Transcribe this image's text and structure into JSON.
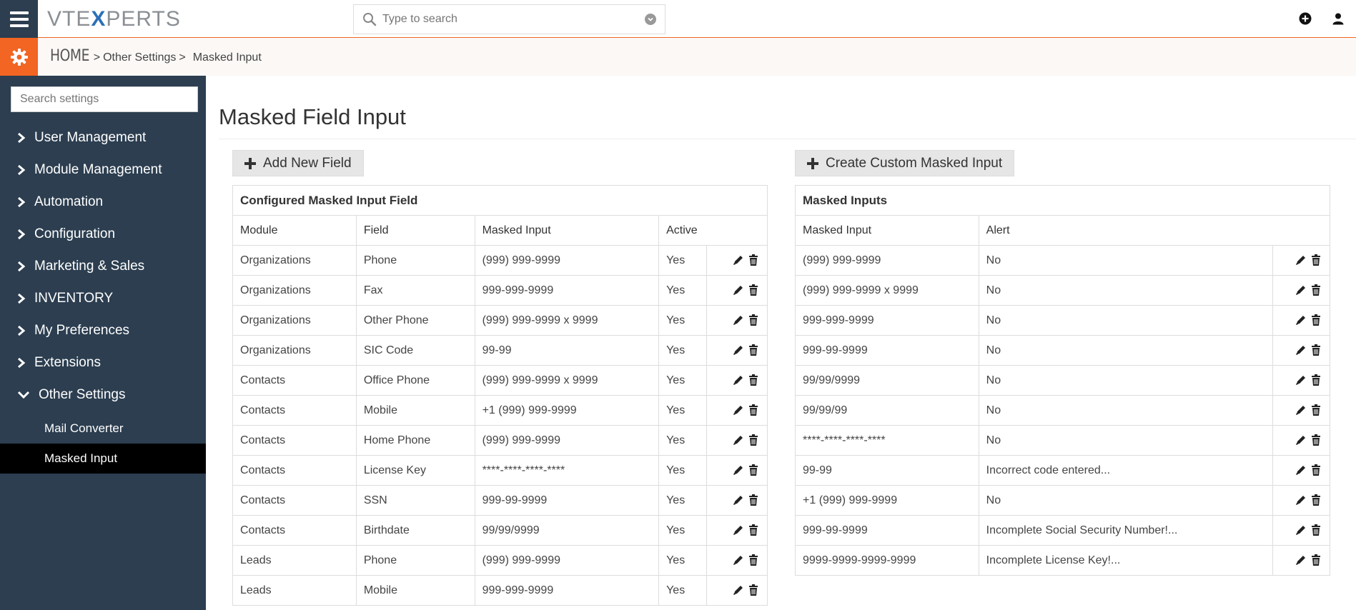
{
  "header": {
    "logo_left": "VTE",
    "logo_x": "X",
    "logo_right": "PERTS",
    "search_placeholder": "Type to search"
  },
  "breadcrumb": {
    "home": "HOME",
    "sep1": ">",
    "item1": "Other Settings",
    "sep2": ">",
    "current": "Masked Input"
  },
  "sidebar": {
    "search_placeholder": "Search settings",
    "items": [
      {
        "label": "User Management"
      },
      {
        "label": "Module Management"
      },
      {
        "label": "Automation"
      },
      {
        "label": "Configuration"
      },
      {
        "label": "Marketing & Sales"
      },
      {
        "label": "INVENTORY"
      },
      {
        "label": "My Preferences"
      },
      {
        "label": "Extensions"
      },
      {
        "label": "Other Settings"
      }
    ],
    "subitems": [
      {
        "label": "Mail Converter"
      },
      {
        "label": "Masked Input"
      }
    ]
  },
  "main": {
    "title": "Masked Field Input",
    "add_button": "Add New Field",
    "create_button": "Create Custom Masked Input",
    "left_table": {
      "caption": "Configured Masked Input Field",
      "headers": [
        "Module",
        "Field",
        "Masked Input",
        "Active"
      ],
      "rows": [
        [
          "Organizations",
          "Phone",
          "(999) 999-9999",
          "Yes"
        ],
        [
          "Organizations",
          "Fax",
          "999-999-9999",
          "Yes"
        ],
        [
          "Organizations",
          "Other Phone",
          "(999) 999-9999 x 9999",
          "Yes"
        ],
        [
          "Organizations",
          "SIC Code",
          "99-99",
          "Yes"
        ],
        [
          "Contacts",
          "Office Phone",
          "(999) 999-9999 x 9999",
          "Yes"
        ],
        [
          "Contacts",
          "Mobile",
          "+1 (999) 999-9999",
          "Yes"
        ],
        [
          "Contacts",
          "Home Phone",
          "(999) 999-9999",
          "Yes"
        ],
        [
          "Contacts",
          "License Key",
          "****-****-****-****",
          "Yes"
        ],
        [
          "Contacts",
          "SSN",
          "999-99-9999",
          "Yes"
        ],
        [
          "Contacts",
          "Birthdate",
          "99/99/9999",
          "Yes"
        ],
        [
          "Leads",
          "Phone",
          "(999) 999-9999",
          "Yes"
        ],
        [
          "Leads",
          "Mobile",
          "999-999-9999",
          "Yes"
        ]
      ]
    },
    "right_table": {
      "caption": "Masked Inputs",
      "headers": [
        "Masked Input",
        "Alert"
      ],
      "rows": [
        [
          "(999) 999-9999",
          "No"
        ],
        [
          "(999) 999-9999 x 9999",
          "No"
        ],
        [
          "999-999-9999",
          "No"
        ],
        [
          "999-99-9999",
          "No"
        ],
        [
          "99/99/9999",
          "No"
        ],
        [
          "99/99/99",
          "No"
        ],
        [
          "****-****-****-****",
          "No"
        ],
        [
          "99-99",
          "Incorrect code entered..."
        ],
        [
          "+1 (999) 999-9999",
          "No"
        ],
        [
          "999-99-9999",
          "Incomplete Social Security Number!..."
        ],
        [
          "9999-9999-9999-9999",
          "Incomplete License Key!..."
        ]
      ]
    }
  },
  "colors": {
    "accent": "#f26522",
    "sidebar": "#2c3e50",
    "active_item": "#000000",
    "logo_x": "#2c6fb7"
  },
  "icons": {
    "menu": "hamburger-icon",
    "search": "search-icon",
    "dropdown": "chevron-down-circle-icon",
    "add": "plus-circle-icon",
    "user": "user-icon",
    "settings": "gear-icon",
    "edit": "pencil-icon",
    "delete": "trash-icon"
  }
}
